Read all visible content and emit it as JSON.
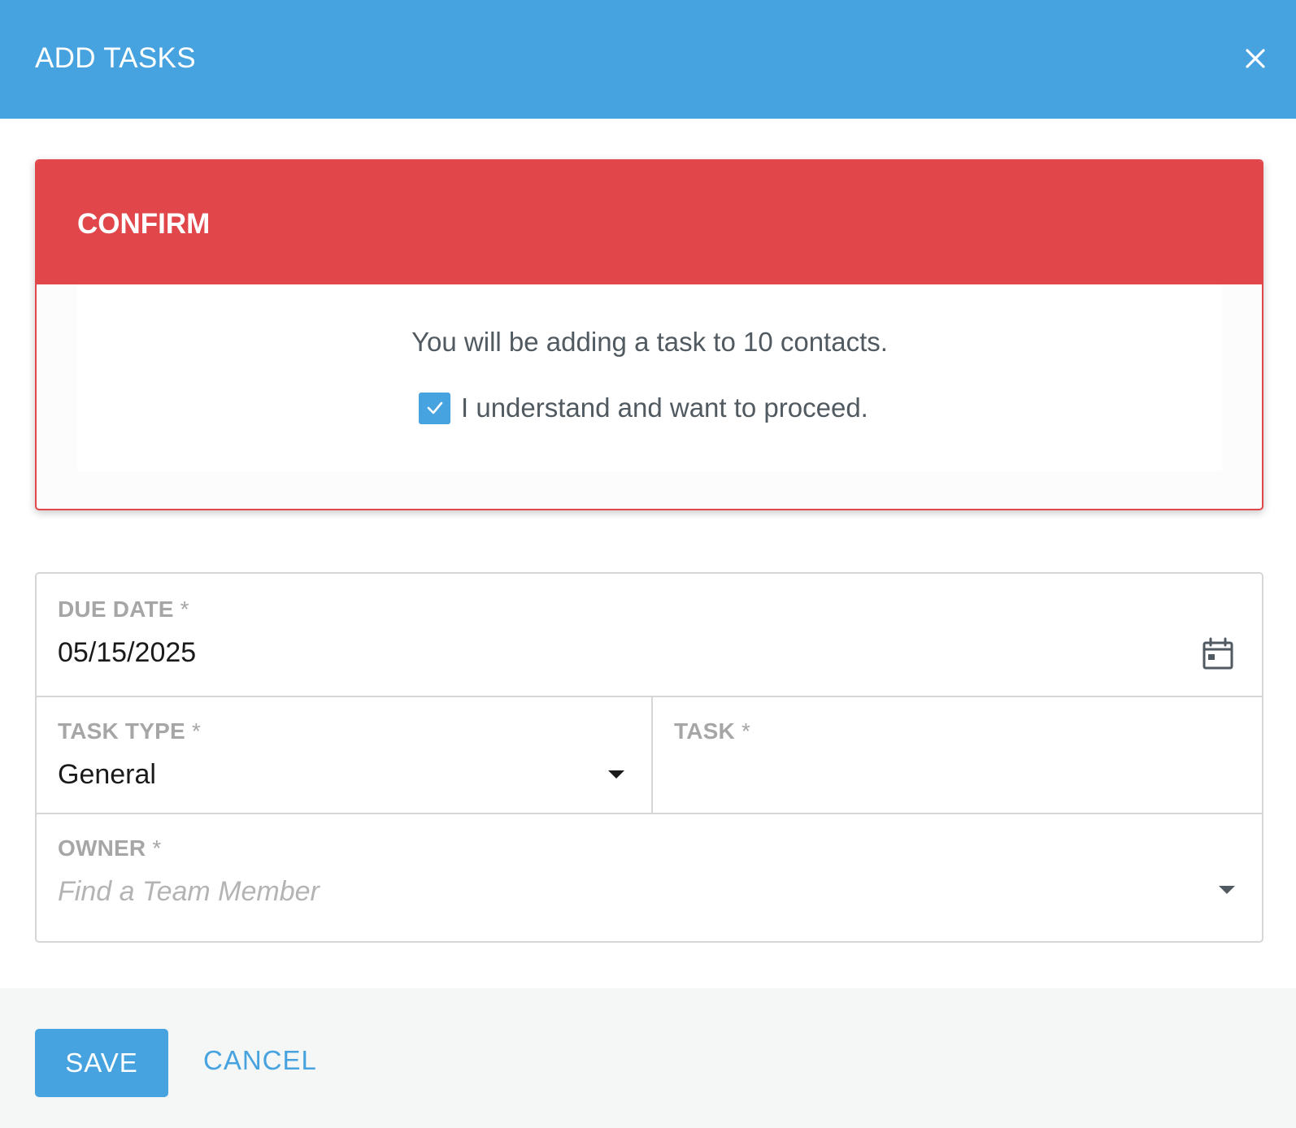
{
  "header": {
    "title": "ADD TASKS",
    "close_icon": "close-icon"
  },
  "confirm": {
    "title": "CONFIRM",
    "message": "You will be adding a task to 10 contacts.",
    "checkbox_label": "I understand and want to proceed.",
    "checkbox_checked": true
  },
  "form": {
    "due_date": {
      "label": "DUE DATE",
      "required_mark": "*",
      "value": "05/15/2025",
      "icon": "calendar-icon"
    },
    "task_type": {
      "label": "TASK TYPE",
      "required_mark": "*",
      "value": "General",
      "icon": "caret-down-icon"
    },
    "task": {
      "label": "TASK",
      "required_mark": "*",
      "value": ""
    },
    "owner": {
      "label": "OWNER",
      "required_mark": "*",
      "placeholder": "Find a Team Member",
      "icon": "caret-down-icon"
    }
  },
  "footer": {
    "save_label": "SAVE",
    "cancel_label": "CANCEL"
  },
  "colors": {
    "header_bg": "#47a3df",
    "confirm_red": "#e0464a",
    "accent_blue": "#47a3df",
    "footer_bg": "#f5f7f7"
  }
}
